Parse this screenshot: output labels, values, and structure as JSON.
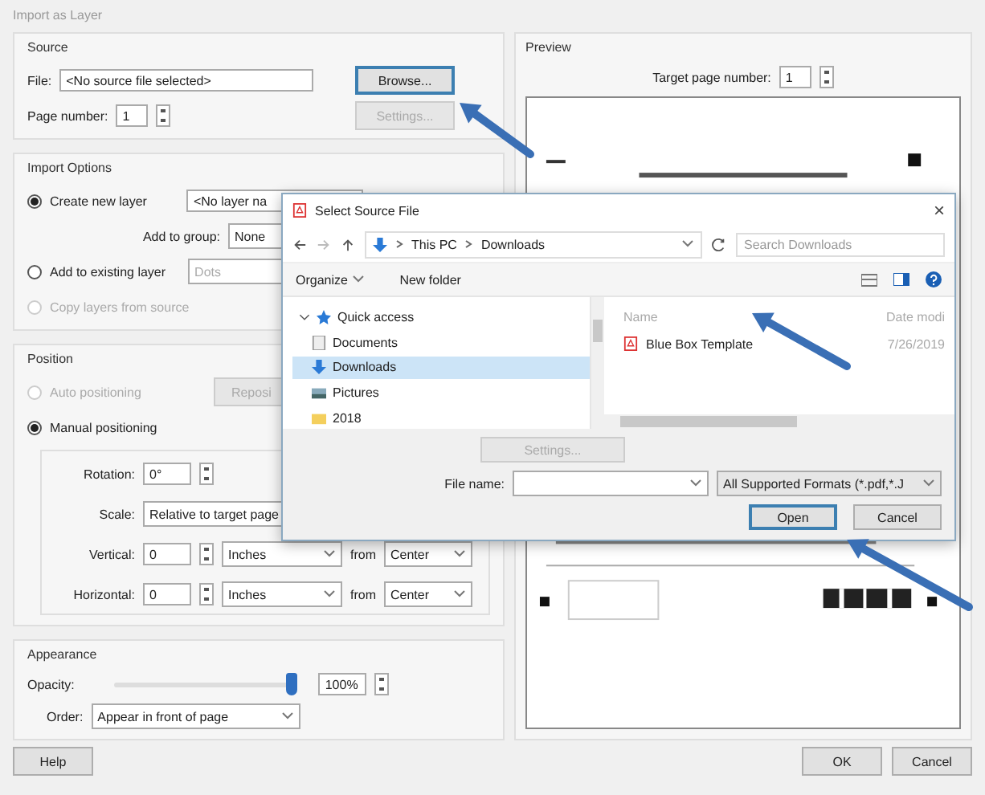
{
  "window": {
    "title": "Import as Layer"
  },
  "source": {
    "title": "Source",
    "file_label": "File:",
    "file_value": "<No source file selected>",
    "browse_button": "Browse...",
    "page_label": "Page number:",
    "page_value": "1",
    "settings_button": {
      "label": "Settings...",
      "disabled": true
    }
  },
  "import_options": {
    "title": "Import Options",
    "options": [
      {
        "label": "Create new layer",
        "selected": true,
        "disabled": false
      },
      {
        "label": "Add to existing layer",
        "selected": false,
        "disabled": false
      },
      {
        "label": "Copy layers from source",
        "selected": false,
        "disabled": true
      }
    ],
    "layer_name": "<No layer na",
    "group_label": "Add to group:",
    "group_value": "None",
    "existing_value": "Dots"
  },
  "position": {
    "title": "Position",
    "modes": [
      {
        "label": "Auto positioning",
        "selected": false,
        "disabled": true
      },
      {
        "label": "Manual positioning",
        "selected": true,
        "disabled": false
      }
    ],
    "reposition_button": {
      "label": "Reposi",
      "disabled": true
    },
    "rotation_label": "Rotation:",
    "rotation_value": "0°",
    "scale_label": "Scale:",
    "scale_value": "Relative to target page",
    "offsets": [
      {
        "label": "Vertical:",
        "value": "0",
        "unit": "Inches",
        "from_label": "from",
        "from_value": "Center"
      },
      {
        "label": "Horizontal:",
        "value": "0",
        "unit": "Inches",
        "from_label": "from",
        "from_value": "Center"
      }
    ]
  },
  "appearance": {
    "title": "Appearance",
    "opacity_label": "Opacity:",
    "opacity": {
      "level": 1.0
    },
    "opacity_value": "100%",
    "order_label": "Order:",
    "order_value": "Appear in front of page"
  },
  "preview": {
    "title": "Preview",
    "target_label": "Target page number:",
    "target_value": "1"
  },
  "buttons": [
    {
      "label": "Help"
    },
    {
      "label": "OK"
    },
    {
      "label": "Cancel"
    }
  ],
  "file_dialog": {
    "title": "Select Source File",
    "close": "×",
    "path": [
      "This PC",
      "Downloads"
    ],
    "search_placeholder": "Search Downloads",
    "toolbar": [
      "Organize",
      "New folder"
    ],
    "nav": [
      {
        "label": "Quick access",
        "expanded": true,
        "children": [
          {
            "label": "Documents",
            "selected": false
          },
          {
            "label": "Downloads",
            "selected": true
          },
          {
            "label": "Pictures",
            "selected": false
          },
          {
            "label": "2018",
            "selected": false
          }
        ]
      }
    ],
    "columns": [
      "Name",
      "Date modi"
    ],
    "files": [
      {
        "name": "Blue Box Template",
        "date": "7/26/2019"
      }
    ],
    "settings_button": {
      "label": "Settings...",
      "disabled": true
    },
    "file_name_label": "File name:",
    "filter": "All Supported Formats (*.pdf,*.J",
    "open_button": "Open",
    "cancel_button": "Cancel"
  }
}
